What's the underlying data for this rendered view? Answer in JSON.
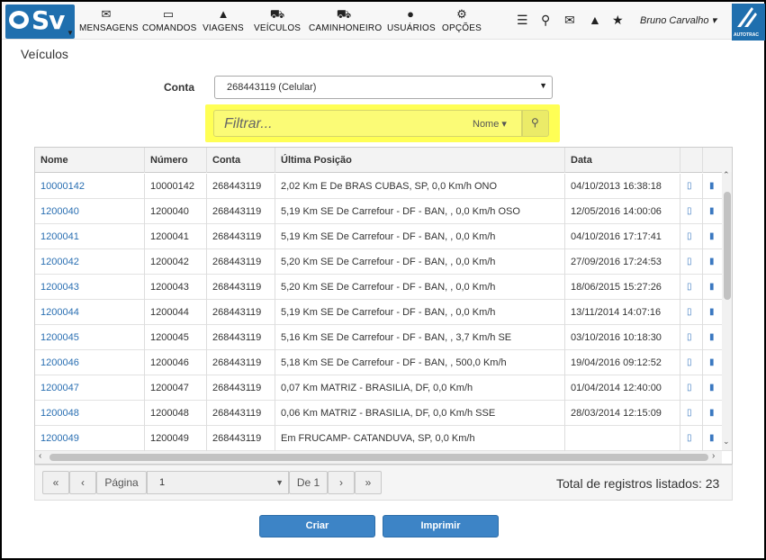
{
  "app": {
    "logo_text": "Sv",
    "user_name": "Bruno Carvalho",
    "brand_text": "AUTOTRAC"
  },
  "nav": [
    {
      "label": "MENSAGENS",
      "icon": "envelope-icon"
    },
    {
      "label": "COMANDOS",
      "icon": "laptop-icon"
    },
    {
      "label": "VIAGENS",
      "icon": "road-icon"
    },
    {
      "label": "VEÍCULOS",
      "icon": "car-icon"
    },
    {
      "label": "CAMINHONEIRO",
      "icon": "truck-icon"
    },
    {
      "label": "USUÁRIOS",
      "icon": "user-icon"
    },
    {
      "label": "OPÇÕES",
      "icon": "gears-icon"
    }
  ],
  "page_title": "Veículos",
  "form": {
    "conta_label": "Conta",
    "conta_value": "268443119 (Celular)",
    "filter_placeholder": "Filtrar...",
    "filter_field": "Nome"
  },
  "table": {
    "columns": [
      "Nome",
      "Número",
      "Conta",
      "Última Posição",
      "Data"
    ],
    "rows": [
      [
        "10000142",
        "10000142",
        "268443119",
        "2,02 Km E De BRAS CUBAS, SP, 0,0 Km/h ONO",
        "04/10/2013 16:38:18"
      ],
      [
        "1200040",
        "1200040",
        "268443119",
        "5,19 Km SE De Carrefour - DF - BAN, , 0,0 Km/h OSO",
        "12/05/2016 14:00:06"
      ],
      [
        "1200041",
        "1200041",
        "268443119",
        "5,19 Km SE De Carrefour - DF - BAN, , 0,0 Km/h",
        "04/10/2016 17:17:41"
      ],
      [
        "1200042",
        "1200042",
        "268443119",
        "5,20 Km SE De Carrefour - DF - BAN, , 0,0 Km/h",
        "27/09/2016 17:24:53"
      ],
      [
        "1200043",
        "1200043",
        "268443119",
        "5,20 Km SE De Carrefour - DF - BAN, , 0,0 Km/h",
        "18/06/2015 15:27:26"
      ],
      [
        "1200044",
        "1200044",
        "268443119",
        "5,19 Km SE De Carrefour - DF - BAN, , 0,0 Km/h",
        "13/11/2014 14:07:16"
      ],
      [
        "1200045",
        "1200045",
        "268443119",
        "5,16 Km SE De Carrefour - DF - BAN, , 3,7 Km/h SE",
        "03/10/2016 10:18:30"
      ],
      [
        "1200046",
        "1200046",
        "268443119",
        "5,18 Km SE De Carrefour - DF - BAN, , 500,0 Km/h",
        "19/04/2016 09:12:52"
      ],
      [
        "1200047",
        "1200047",
        "268443119",
        "0,07 Km MATRIZ - BRASILIA, DF, 0,0 Km/h",
        "01/04/2014 12:40:00"
      ],
      [
        "1200048",
        "1200048",
        "268443119",
        "0,06 Km MATRIZ - BRASILIA, DF, 0,0 Km/h SSE",
        "28/03/2014 12:15:09"
      ],
      [
        "1200049",
        "1200049",
        "268443119",
        "Em FRUCAMP- CATANDUVA, SP, 0,0 Km/h",
        ""
      ]
    ]
  },
  "pager": {
    "page_label": "Página",
    "page_value": "1",
    "of_label": "De 1",
    "total_label": "Total de registros listados: 23"
  },
  "actions": {
    "criar": "Criar",
    "imprimir": "Imprimir"
  },
  "colors": {
    "accent": "#3d84c6",
    "filter_highlight": "#ffff55",
    "link": "#2a6fb2"
  }
}
